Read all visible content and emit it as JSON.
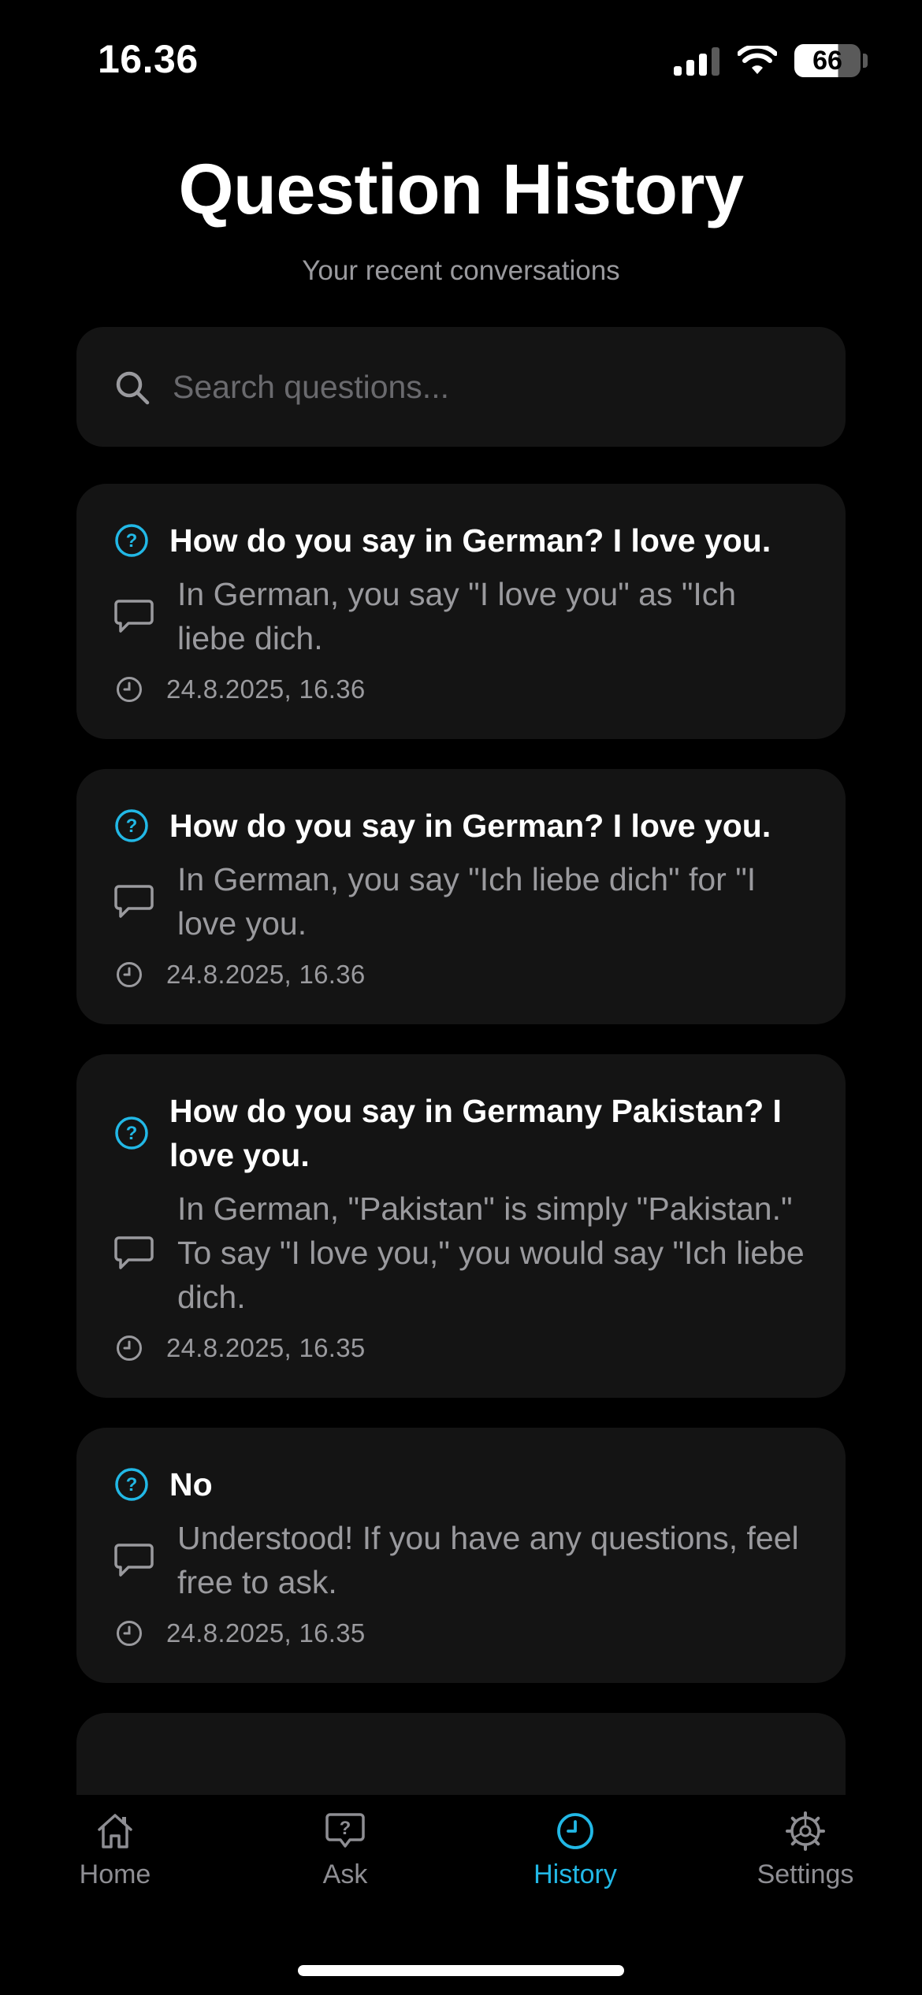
{
  "status_bar": {
    "time": "16.36",
    "battery": "66",
    "battery_percent": 66
  },
  "header": {
    "title": "Question History",
    "subtitle": "Your recent conversations"
  },
  "search": {
    "value": "",
    "placeholder": "Search questions..."
  },
  "history": [
    {
      "question": "How do you say in German? I love you.",
      "answer": "In German, you say \"I love you\" as \"Ich liebe dich.",
      "timestamp": "24.8.2025, 16.36"
    },
    {
      "question": "How do you say in German? I love you.",
      "answer": "In German, you say \"Ich liebe dich\" for \"I love you.",
      "timestamp": "24.8.2025, 16.36"
    },
    {
      "question": "How do you say in Germany Pakistan? I love you.",
      "answer": "In German, \"Pakistan\" is simply \"Pakistan.\" To say \"I love you,\" you would say \"Ich liebe dich.",
      "timestamp": "24.8.2025, 16.35"
    },
    {
      "question": "No",
      "answer": "Understood! If you have any questions, feel free to ask.",
      "timestamp": "24.8.2025, 16.35"
    }
  ],
  "tabs": [
    {
      "label": "Home",
      "icon": "home-icon",
      "active": false
    },
    {
      "label": "Ask",
      "icon": "question-bubble-icon",
      "active": false
    },
    {
      "label": "History",
      "icon": "clock-icon",
      "active": true
    },
    {
      "label": "Settings",
      "icon": "gear-icon",
      "active": false
    }
  ],
  "colors": {
    "background": "#000000",
    "card": "#141414",
    "accent": "#22b8e6",
    "secondary_text": "#9a9a9e"
  }
}
